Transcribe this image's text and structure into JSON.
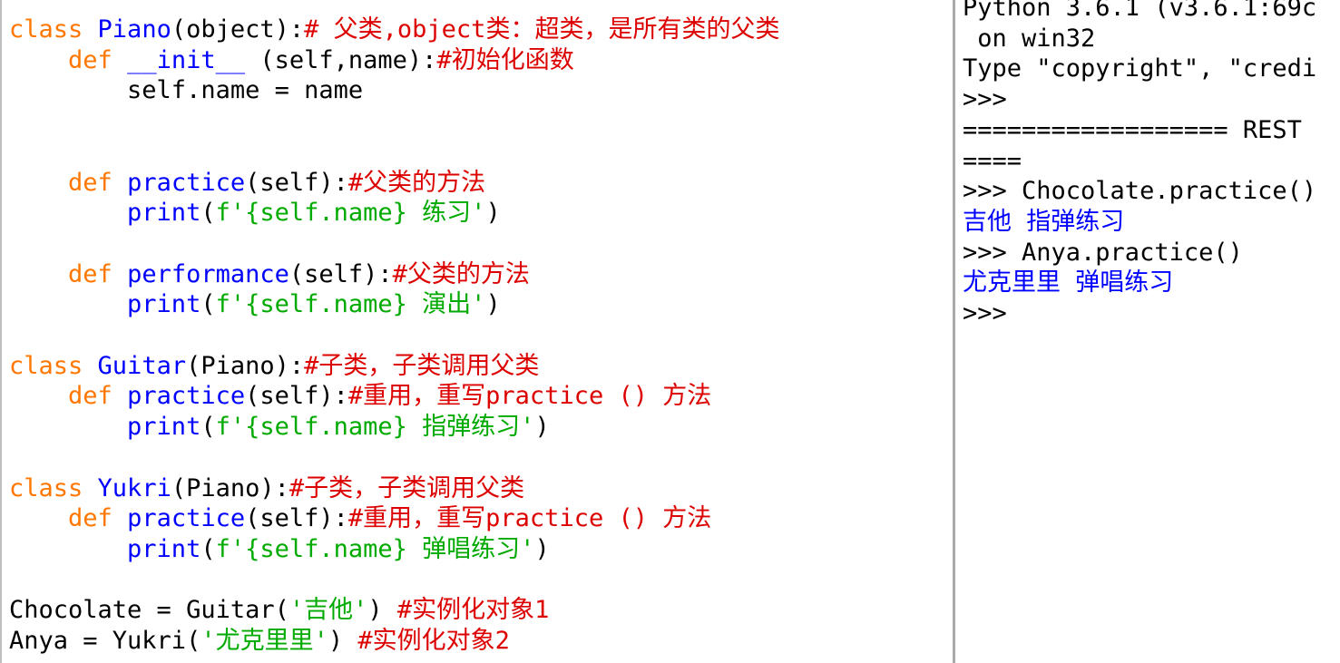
{
  "editor": {
    "lines": [
      {
        "segments": [
          {
            "t": "class",
            "c": "kw"
          },
          {
            "t": " ",
            "c": "bl"
          },
          {
            "t": "Piano",
            "c": "def"
          },
          {
            "t": "(object):",
            "c": "bl"
          },
          {
            "t": "# 父类,object类：超类，是所有类的父类",
            "c": "cm"
          }
        ]
      },
      {
        "segments": [
          {
            "t": "    def",
            "c": "kw"
          },
          {
            "t": " ",
            "c": "bl"
          },
          {
            "t": "__init__",
            "c": "def"
          },
          {
            "t": " (self,name):",
            "c": "bl"
          },
          {
            "t": "#初始化函数",
            "c": "cm"
          }
        ]
      },
      {
        "segments": [
          {
            "t": "        self.name = name",
            "c": "bl"
          }
        ]
      },
      {
        "segments": []
      },
      {
        "segments": []
      },
      {
        "segments": [
          {
            "t": "    def",
            "c": "kw"
          },
          {
            "t": " ",
            "c": "bl"
          },
          {
            "t": "practice",
            "c": "def"
          },
          {
            "t": "(self):",
            "c": "bl"
          },
          {
            "t": "#父类的方法",
            "c": "cm"
          }
        ]
      },
      {
        "segments": [
          {
            "t": "        print",
            "c": "def"
          },
          {
            "t": "(",
            "c": "bl"
          },
          {
            "t": "f'{self.name} 练习'",
            "c": "st"
          },
          {
            "t": ")",
            "c": "bl"
          }
        ]
      },
      {
        "segments": []
      },
      {
        "segments": [
          {
            "t": "    def",
            "c": "kw"
          },
          {
            "t": " ",
            "c": "bl"
          },
          {
            "t": "performance",
            "c": "def"
          },
          {
            "t": "(self):",
            "c": "bl"
          },
          {
            "t": "#父类的方法",
            "c": "cm"
          }
        ]
      },
      {
        "segments": [
          {
            "t": "        print",
            "c": "def"
          },
          {
            "t": "(",
            "c": "bl"
          },
          {
            "t": "f'{self.name} 演出'",
            "c": "st"
          },
          {
            "t": ")",
            "c": "bl"
          }
        ]
      },
      {
        "segments": []
      },
      {
        "segments": [
          {
            "t": "class",
            "c": "kw"
          },
          {
            "t": " ",
            "c": "bl"
          },
          {
            "t": "Guitar",
            "c": "def"
          },
          {
            "t": "(Piano):",
            "c": "bl"
          },
          {
            "t": "#子类，子类调用父类",
            "c": "cm"
          }
        ]
      },
      {
        "segments": [
          {
            "t": "    def",
            "c": "kw"
          },
          {
            "t": " ",
            "c": "bl"
          },
          {
            "t": "practice",
            "c": "def"
          },
          {
            "t": "(self):",
            "c": "bl"
          },
          {
            "t": "#重用，重写practice () 方法",
            "c": "cm"
          }
        ]
      },
      {
        "segments": [
          {
            "t": "        print",
            "c": "def"
          },
          {
            "t": "(",
            "c": "bl"
          },
          {
            "t": "f'{self.name} 指弹练习'",
            "c": "st"
          },
          {
            "t": ")",
            "c": "bl"
          }
        ]
      },
      {
        "segments": []
      },
      {
        "segments": [
          {
            "t": "class",
            "c": "kw"
          },
          {
            "t": " ",
            "c": "bl"
          },
          {
            "t": "Yukri",
            "c": "def"
          },
          {
            "t": "(Piano):",
            "c": "bl"
          },
          {
            "t": "#子类，子类调用父类",
            "c": "cm"
          }
        ]
      },
      {
        "segments": [
          {
            "t": "    def",
            "c": "kw"
          },
          {
            "t": " ",
            "c": "bl"
          },
          {
            "t": "practice",
            "c": "def"
          },
          {
            "t": "(self):",
            "c": "bl"
          },
          {
            "t": "#重用，重写practice () 方法",
            "c": "cm"
          }
        ]
      },
      {
        "segments": [
          {
            "t": "        print",
            "c": "def"
          },
          {
            "t": "(",
            "c": "bl"
          },
          {
            "t": "f'{self.name} 弹唱练习'",
            "c": "st"
          },
          {
            "t": ")",
            "c": "bl"
          }
        ]
      },
      {
        "segments": []
      },
      {
        "segments": [
          {
            "t": "Chocolate = Guitar(",
            "c": "bl"
          },
          {
            "t": "'吉他'",
            "c": "st"
          },
          {
            "t": ") ",
            "c": "bl"
          },
          {
            "t": "#实例化对象1",
            "c": "cm"
          }
        ]
      },
      {
        "segments": [
          {
            "t": "Anya = Yukri(",
            "c": "bl"
          },
          {
            "t": "'尤克里里'",
            "c": "st"
          },
          {
            "t": ") ",
            "c": "bl"
          },
          {
            "t": "#实例化对象2",
            "c": "cm"
          }
        ]
      }
    ]
  },
  "shell": {
    "lines": [
      {
        "segments": [
          {
            "t": "Python 3.6.1 (v3.6.1:69c",
            "c": "bl"
          }
        ]
      },
      {
        "segments": [
          {
            "t": " on win32",
            "c": "bl"
          }
        ]
      },
      {
        "segments": [
          {
            "t": "Type \"copyright\", \"credi",
            "c": "bl"
          }
        ]
      },
      {
        "segments": [
          {
            "t": ">>>",
            "c": "bl"
          }
        ]
      },
      {
        "segments": [
          {
            "t": "================== REST",
            "c": "bl"
          }
        ]
      },
      {
        "segments": [
          {
            "t": "====",
            "c": "bl"
          }
        ]
      },
      {
        "segments": [
          {
            "t": ">>> Chocolate.practice()",
            "c": "bl"
          }
        ]
      },
      {
        "segments": [
          {
            "t": "吉他 指弹练习",
            "c": "shout"
          }
        ]
      },
      {
        "segments": [
          {
            "t": ">>> Anya.practice()",
            "c": "bl"
          }
        ]
      },
      {
        "segments": [
          {
            "t": "尤克里里 弹唱练习",
            "c": "shout"
          }
        ]
      },
      {
        "segments": [
          {
            "t": ">>>",
            "c": "bl"
          }
        ]
      }
    ]
  }
}
